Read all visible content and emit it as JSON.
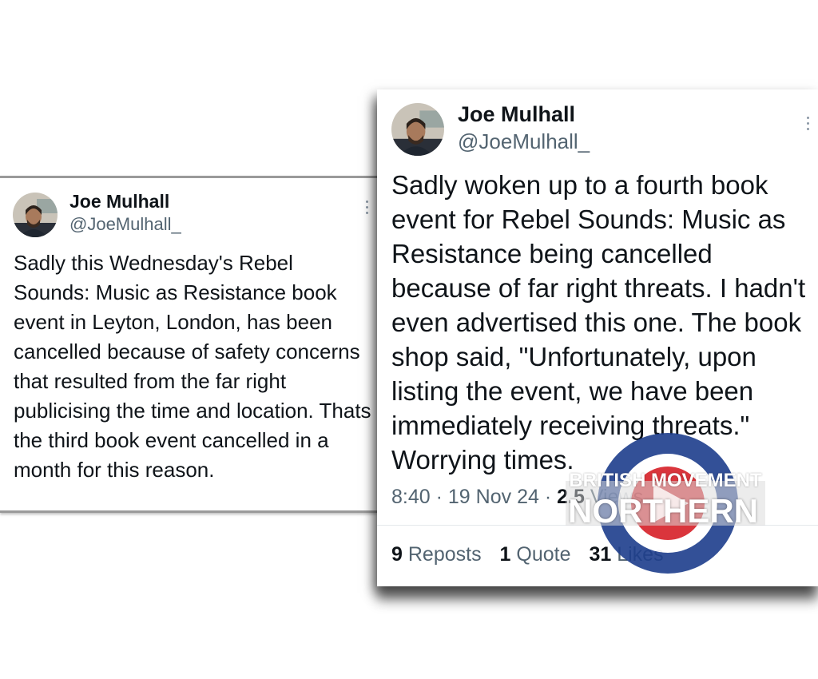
{
  "left_tweet": {
    "name": "Joe Mulhall",
    "handle": "@JoeMulhall_",
    "text": "Sadly this Wednesday's Rebel Sounds: Music as Resistance book event in Leyton, London, has been cancelled because of safety concerns that resulted from the far right publicising the time and location. Thats the third book event cancelled in a month for this reason."
  },
  "right_tweet": {
    "name": "Joe Mulhall",
    "handle": "@JoeMulhall_",
    "text": "Sadly woken up to a fourth book event for Rebel Sounds: Music as Resistance being cancelled because of far right threats. I hadn't even advertised this one. The book shop said, \"Unfortunately, upon listing the event, we have been immediately receiving threats.\" Worrying times.",
    "time": "8:40",
    "separator": "·",
    "date": "19 Nov 24",
    "views_partial": "2.5",
    "views_label": "Views",
    "stats": [
      {
        "count": "9",
        "label": "Reposts"
      },
      {
        "count": "1",
        "label": "Quote"
      },
      {
        "count": "31",
        "label": "Likes"
      }
    ]
  },
  "watermark": {
    "line1": "BRITISH MOVEMENT",
    "line2": "NORTHERN",
    "colors": {
      "outer": "#1d3e8c",
      "ring": "#ffffff",
      "inner": "#d62027",
      "stripe": "#ffffff"
    }
  },
  "colors": {
    "text": "#0f1419",
    "secondary": "#536471",
    "card_border": "#9a9a9a"
  },
  "icons": [
    "avatar",
    "more-options-icon"
  ]
}
